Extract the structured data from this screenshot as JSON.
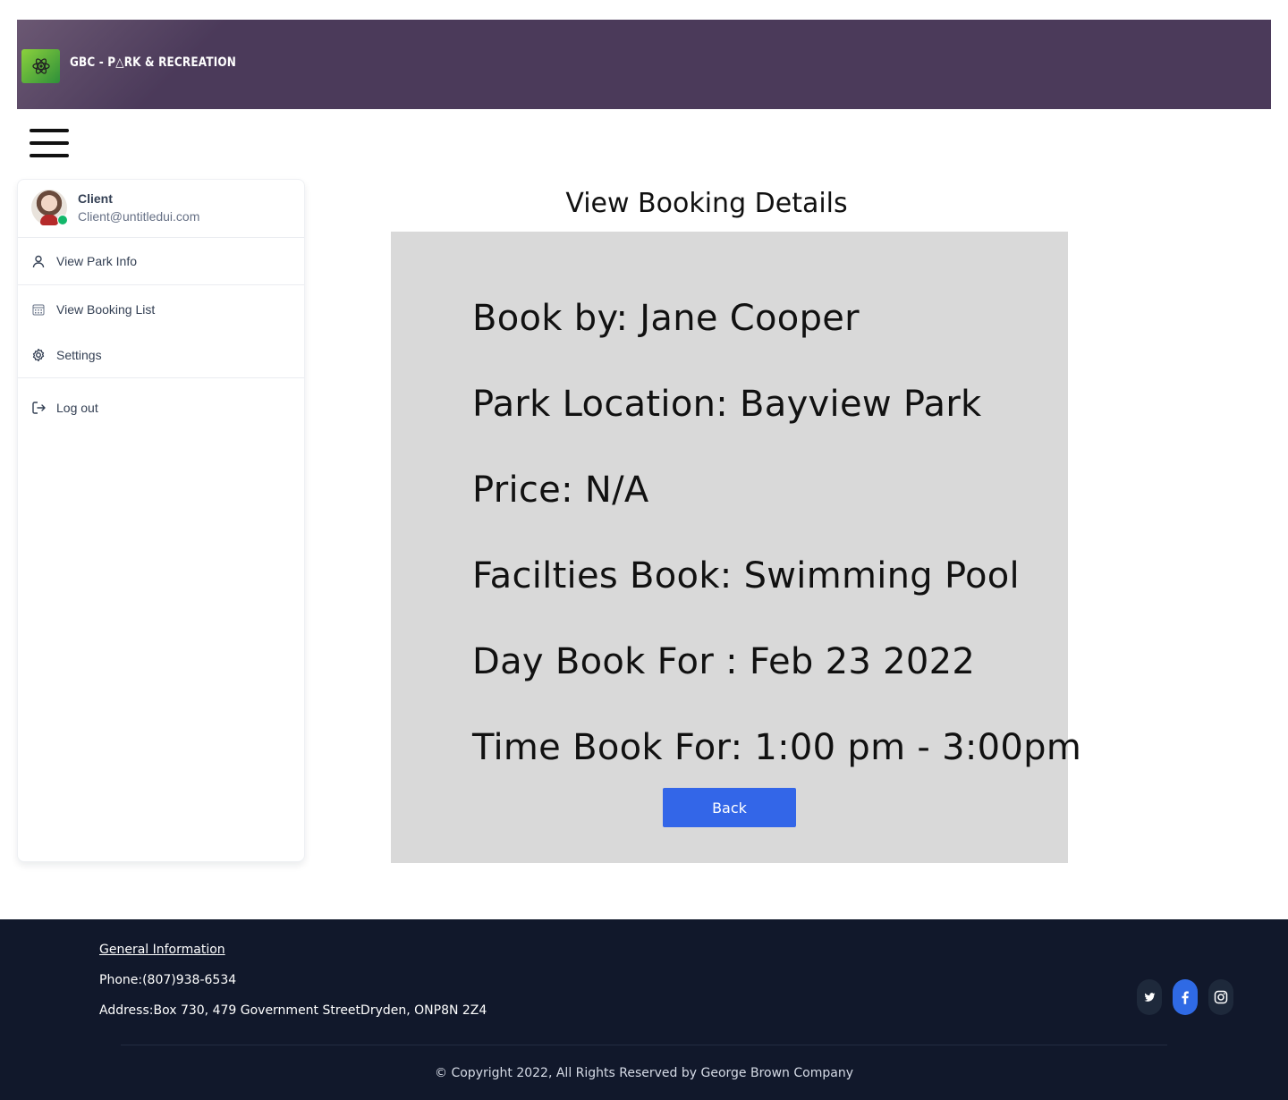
{
  "header": {
    "brand_text": "GBC - P△RK & RECREATION"
  },
  "sidebar": {
    "profile": {
      "name": "Client",
      "email": "Client@untitledui.com"
    },
    "items": [
      {
        "label": "View Park Info",
        "icon": "user-icon"
      },
      {
        "label": "View Booking List",
        "icon": "calendar-icon"
      },
      {
        "label": "Settings",
        "icon": "gear-icon"
      },
      {
        "label": "Log out",
        "icon": "logout-icon"
      }
    ]
  },
  "main": {
    "title": "View Booking Details",
    "details": [
      "Book by: Jane Cooper",
      "Park Location: Bayview Park",
      "Price: N/A",
      "Facilties Book: Swimming Pool",
      "Day Book For : Feb 23 2022",
      "Time Book For: 1:00 pm - 3:00pm"
    ],
    "back_label": "Back"
  },
  "footer": {
    "heading": "General Information",
    "phone": "Phone:(807)938-6534",
    "address": "Address:Box 730, 479 Government StreetDryden, ONP8N 2Z4",
    "copyright": "© Copyright 2022, All Rights Reserved by George Brown Company",
    "social": [
      "twitter-icon",
      "facebook-icon",
      "instagram-icon"
    ]
  },
  "colors": {
    "banner": "#4b3a5a",
    "card": "#d9d9d9",
    "button": "#3366e8",
    "footer": "#11182b",
    "online": "#12b76a"
  }
}
